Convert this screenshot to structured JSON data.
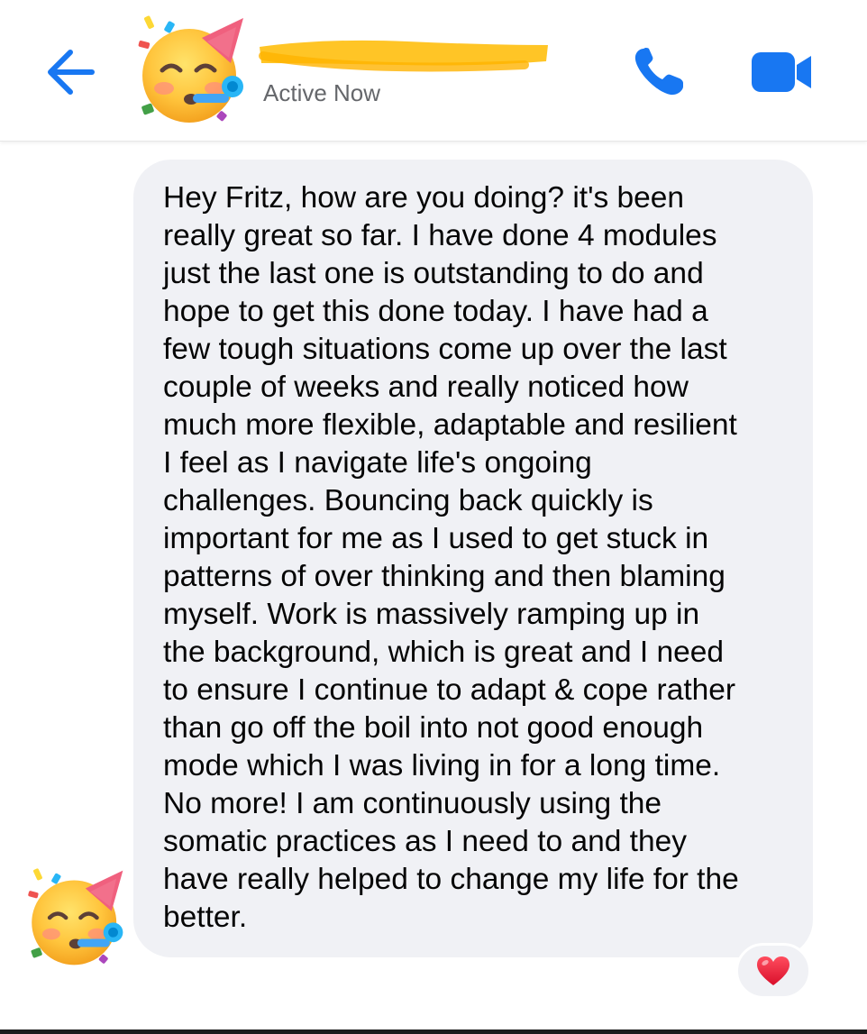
{
  "header": {
    "contact_name": "",
    "status": "Active Now",
    "back_icon": "back-arrow-icon",
    "call_icon": "phone-icon",
    "video_icon": "video-camera-icon",
    "avatar_emoji": "partying-face"
  },
  "colors": {
    "accent": "#1877f2",
    "bubble": "#f0f1f5",
    "redaction": "#ffc21a",
    "heart": "#e8112d"
  },
  "message": {
    "text": "Hey Fritz, how are you doing? it's been\nreally great so far. I have done 4 modules\njust the last one is outstanding to do and\nhope to get this done today. I have had a\nfew tough situations come up over the last\ncouple of weeks and really noticed how\nmuch more flexible, adaptable and resilient\nI feel as I navigate life's ongoing\nchallenges. Bouncing back quickly is\nimportant for me as I used to get stuck in\npatterns of over thinking and then blaming\nmyself. Work is massively ramping up in\nthe background, which is great and I need\nto ensure I continue to adapt & cope rather\nthan go off the boil into not good enough\nmode which I was living in for a long time.\nNo more! I am continuously using the\nsomatic practices as I need to and they\nhave really helped to change my life for the\nbetter.",
    "reaction": "heart-icon"
  }
}
